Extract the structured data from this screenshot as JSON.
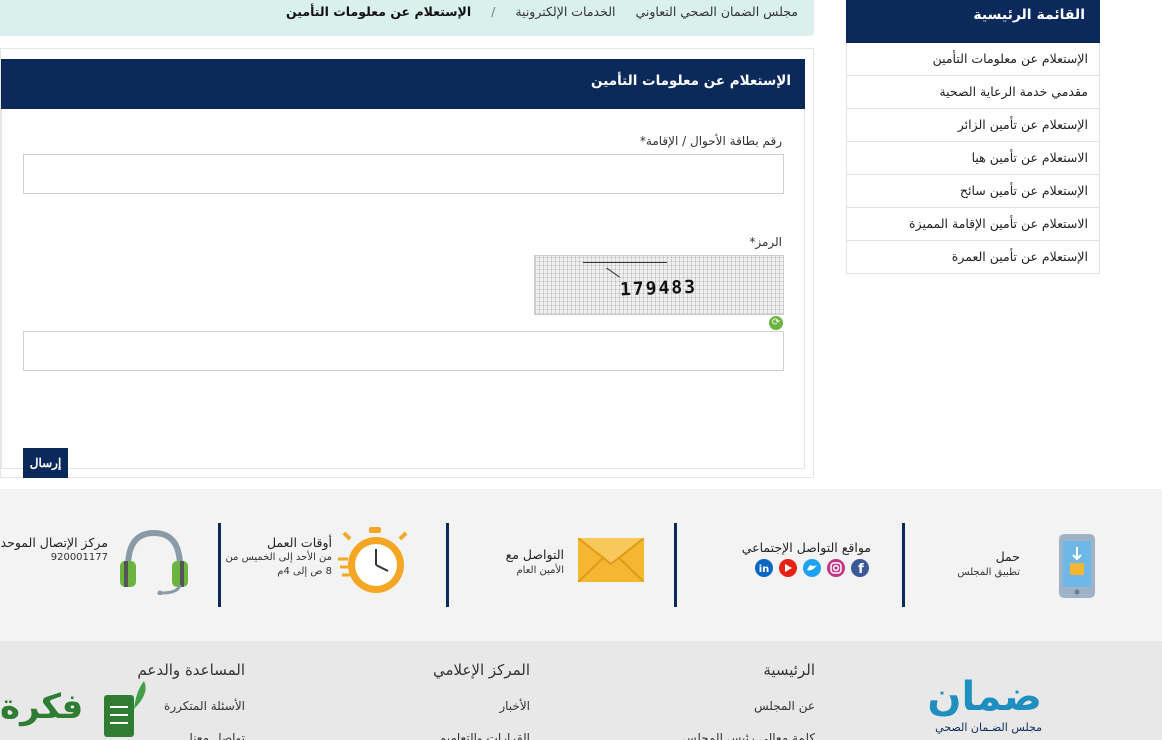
{
  "breadcrumb": {
    "items": [
      "مجلس الضمان الصحي التعاوني",
      "الخدمات الإلكترونية",
      "/"
    ],
    "current": "الإستعلام عن معلومات التأمين"
  },
  "sidebar": {
    "title": "القائمة الرئيسية",
    "items": [
      {
        "label": "الإستعلام عن معلومات التأمين"
      },
      {
        "label": "مقدمي خدمة الرعاية الصحية"
      },
      {
        "label": "الإستعلام عن تأمين الزائر"
      },
      {
        "label": "الاستعلام عن تأمين هيا"
      },
      {
        "label": "الإستعلام عن تأمين سائح"
      },
      {
        "label": "الاستعلام عن تأمين الإقامة المميزة"
      },
      {
        "label": "الإستعلام عن تأمين العمرة"
      }
    ]
  },
  "form": {
    "title": "الإستعلام عن معلومات التأمين",
    "id_label": "رقم بطاقة الأحوال / الإقامة*",
    "id_value": "",
    "code_label": "الرمز*",
    "captcha_text": "179483",
    "code_value": "",
    "submit_label": "إرسال"
  },
  "info": {
    "app_title": "حمل",
    "app_sub": "تطبيق المجلس",
    "social_title": "مواقع التواصل الإجتماعي",
    "contact_title": "التواصل مع",
    "contact_sub": "الأمين العام",
    "hours_title": "أوقات العمل",
    "hours_line1": "من الأحد إلى الخميس من",
    "hours_line2": "8 ص إلى 4م",
    "call_title": "مركز الإتصال الموحد",
    "call_number": "920001177"
  },
  "footer": {
    "col_home": {
      "title": "الرئيسية",
      "links": [
        "عن المجلس",
        "كلمة معالي رئيس المجلس"
      ]
    },
    "col_media": {
      "title": "المركز الإعلامي",
      "links": [
        "الأخبار",
        "القرارات والتعاميم"
      ]
    },
    "col_help": {
      "title": "المساعدة والدعم",
      "links": [
        "الأسئلة المتكررة",
        "تواصل معنا"
      ]
    },
    "logo_main": "ضمان",
    "logo_sub": "مجلس الضـمان الصحي",
    "watermark": "فكرة"
  },
  "colors": {
    "primary": "#0b2a5b",
    "breadcrumb_bg": "#d9f0ec",
    "accent_green": "#6cb33f"
  }
}
